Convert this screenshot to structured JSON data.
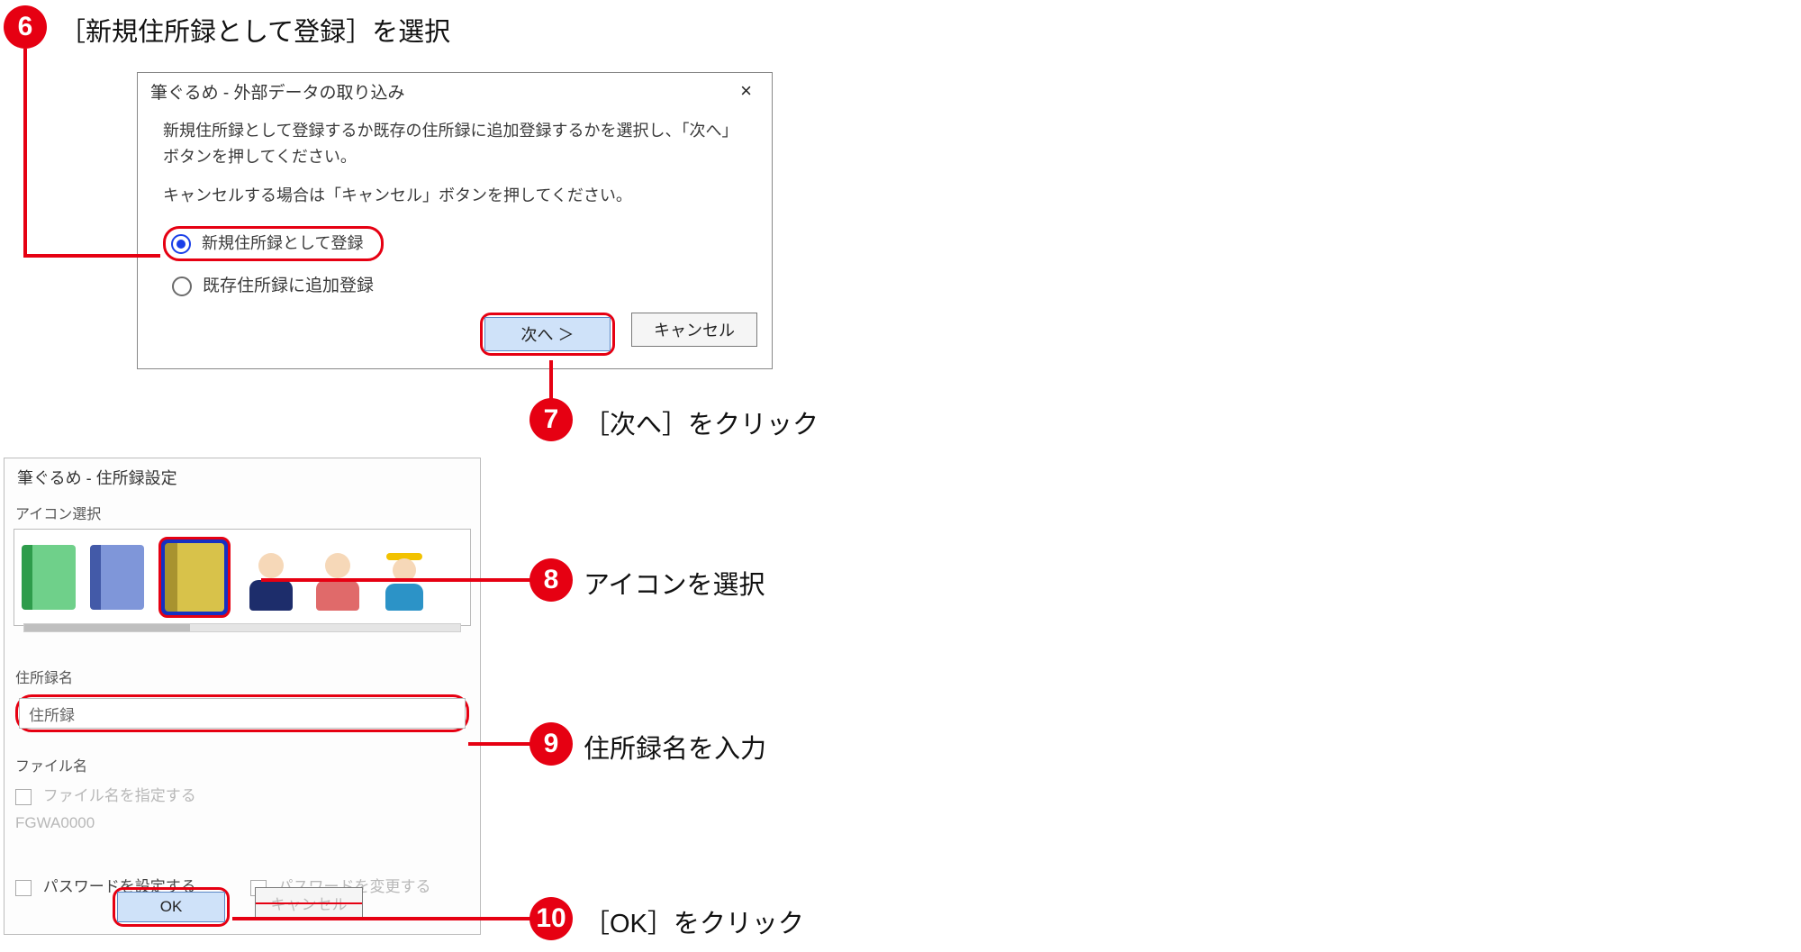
{
  "step6": {
    "caption": "［新規住所録として登録］を選択"
  },
  "step7": {
    "caption": "［次へ］をクリック"
  },
  "step8": {
    "caption": "アイコンを選択"
  },
  "step9": {
    "caption": "住所録名を入力"
  },
  "step10": {
    "caption": "［OK］をクリック"
  },
  "dialog1": {
    "title": "筆ぐるめ - 外部データの取り込み",
    "close": "×",
    "instruction1": "新規住所録として登録するか既存の住所録に追加登録するかを選択し、「次へ」ボタンを押してください。",
    "instruction2": "キャンセルする場合は「キャンセル」ボタンを押してください。",
    "radio_new": "新規住所録として登録",
    "radio_existing": "既存住所録に追加登録",
    "next": "次へ ＞",
    "cancel": "キャンセル"
  },
  "dialog2": {
    "title": "筆ぐるめ - 住所録設定",
    "icon_section": "アイコン選択",
    "name_section": "住所録名",
    "name_value": "住所録",
    "file_section": "ファイル名",
    "file_specify": "ファイル名を指定する",
    "file_value": "FGWA0000",
    "pwd_set": "パスワードを設定する",
    "pwd_change": "パスワードを変更する",
    "ok": "OK",
    "cancel": "キャンセル"
  }
}
